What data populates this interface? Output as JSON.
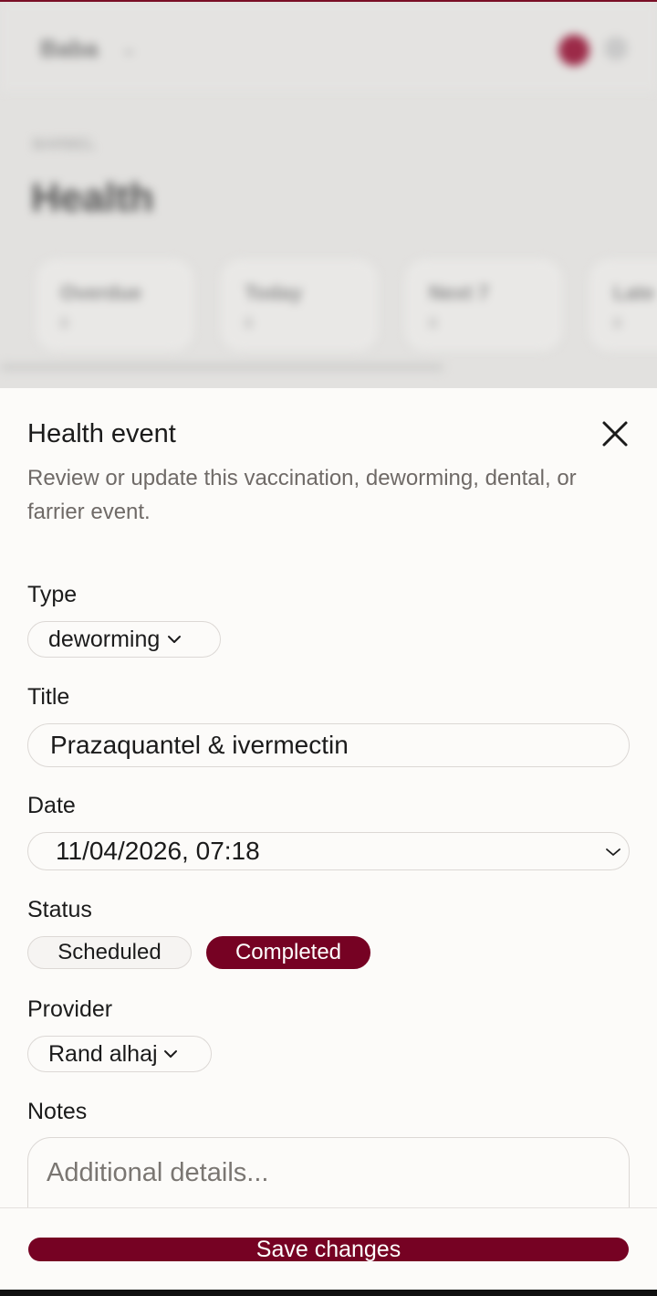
{
  "background": {
    "brand": "Baba",
    "kicker": "BARBEL",
    "title": "Health",
    "cards": [
      {
        "label": "Overdue",
        "value": "0"
      },
      {
        "label": "Today",
        "value": "0"
      },
      {
        "label": "Next 7",
        "value": "0"
      },
      {
        "label": "Late",
        "value": "0"
      }
    ]
  },
  "sheet": {
    "title": "Health event",
    "description": "Review or update this vaccination, deworming, dental, or farrier event.",
    "close_icon": "close-icon",
    "type": {
      "label": "Type",
      "value": "deworming"
    },
    "title_field": {
      "label": "Title",
      "value": "Prazaquantel & ivermectin"
    },
    "date": {
      "label": "Date",
      "value": "11/04/2026, 07:18"
    },
    "status": {
      "label": "Status",
      "options": [
        "Scheduled",
        "Completed"
      ],
      "selected": "Completed"
    },
    "provider": {
      "label": "Provider",
      "value": "Rand alhaj"
    },
    "notes": {
      "label": "Notes",
      "placeholder": "Additional details..."
    }
  },
  "footer": {
    "save_label": "Save changes"
  },
  "colors": {
    "accent": "#760223",
    "sheet_bg": "#fcfbf9",
    "border": "#dcd8d5",
    "muted_text": "#6f6a67"
  }
}
